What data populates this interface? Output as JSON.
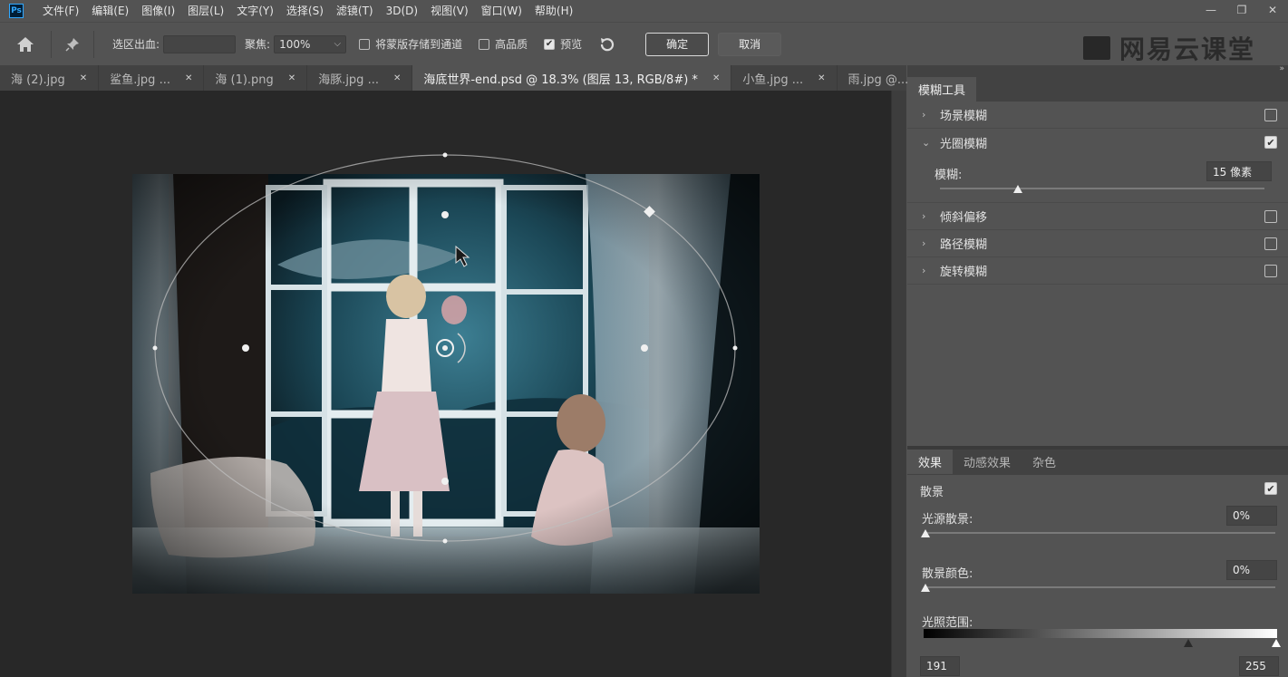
{
  "menubar": {
    "logo": "Ps",
    "items": [
      "文件(F)",
      "编辑(E)",
      "图像(I)",
      "图层(L)",
      "文字(Y)",
      "选择(S)",
      "滤镜(T)",
      "3D(D)",
      "视图(V)",
      "窗口(W)",
      "帮助(H)"
    ],
    "window_controls": [
      "—",
      "❐",
      "✕"
    ]
  },
  "options": {
    "selection_bleed_label": "选区出血:",
    "selection_bleed_value": "",
    "focus_label": "聚焦:",
    "focus_value": "100%",
    "save_mask_label": "将蒙版存储到通道",
    "save_mask_checked": false,
    "high_quality_label": "高品质",
    "high_quality_checked": false,
    "preview_label": "预览",
    "preview_checked": true,
    "ok_label": "确定",
    "cancel_label": "取消",
    "watermark": "网易云课堂"
  },
  "tabs": [
    {
      "label": "海 (2).jpg",
      "active": false
    },
    {
      "label": "鲨鱼.jpg ...",
      "active": false
    },
    {
      "label": "海 (1).png",
      "active": false
    },
    {
      "label": "海豚.jpg ...",
      "active": false
    },
    {
      "label": "海底世界-end.psd @ 18.3% (图层 13, RGB/8#) *",
      "active": true
    },
    {
      "label": "小鱼.jpg ...",
      "active": false
    },
    {
      "label": "雨.jpg @...",
      "active": false
    }
  ],
  "blur_tools": {
    "panel_title": "模糊工具",
    "rows": [
      {
        "label": "场景模糊",
        "checked": false,
        "expanded": false
      },
      {
        "label": "光圈模糊",
        "checked": true,
        "expanded": true
      },
      {
        "label": "倾斜偏移",
        "checked": false,
        "expanded": false
      },
      {
        "label": "路径模糊",
        "checked": false,
        "expanded": false
      },
      {
        "label": "旋转模糊",
        "checked": false,
        "expanded": false
      }
    ],
    "blur_label": "模糊:",
    "blur_value": "15 像素",
    "blur_fraction": 0.24
  },
  "effects": {
    "tabs": [
      "效果",
      "动感效果",
      "杂色"
    ],
    "bokeh_label": "散景",
    "bokeh_checked": true,
    "light_bokeh_label": "光源散景:",
    "light_bokeh_value": "0%",
    "bokeh_color_label": "散景颜色:",
    "bokeh_color_value": "0%",
    "light_range_label": "光照范围:",
    "light_range_low": "191",
    "light_range_high": "255",
    "light_range_low_fraction": 0.749,
    "light_range_high_fraction": 1.0
  }
}
